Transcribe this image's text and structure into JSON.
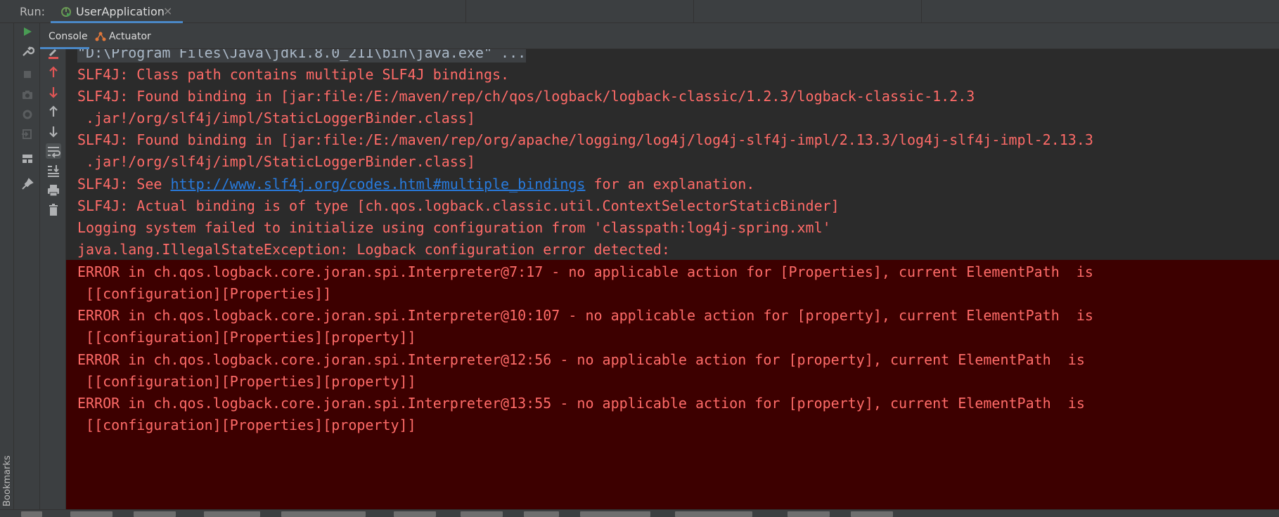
{
  "run": {
    "label": "Run:",
    "tab_label": "UserApplication",
    "tab_close": "×"
  },
  "console_tabs": [
    {
      "label": "Console",
      "active": true
    },
    {
      "label": "Actuator",
      "active": false
    }
  ],
  "bookmarks_label": "Bookmarks",
  "output": {
    "command": "\"D:\\Program Files\\Java\\jdk1.8.0_211\\bin\\java.exe\" ...",
    "lines": [
      "SLF4J: Class path contains multiple SLF4J bindings.",
      "SLF4J: Found binding in [jar:file:/E:/maven/rep/ch/qos/logback/logback-classic/1.2.3/logback-classic-1.2.3",
      " .jar!/org/slf4j/impl/StaticLoggerBinder.class]",
      "SLF4J: Found binding in [jar:file:/E:/maven/rep/org/apache/logging/log4j/log4j-slf4j-impl/2.13.3/log4j-slf4j-impl-2.13.3",
      " .jar!/org/slf4j/impl/StaticLoggerBinder.class]"
    ],
    "see_prefix": "SLF4J: See ",
    "see_link": "http://www.slf4j.org/codes.html#multiple_bindings",
    "see_suffix": " for an explanation.",
    "lines2": [
      "SLF4J: Actual binding is of type [ch.qos.logback.classic.util.ContextSelectorStaticBinder]",
      "Logging system failed to initialize using configuration from 'classpath:log4j-spring.xml'",
      "java.lang.IllegalStateException: Logback configuration error detected:"
    ],
    "errors": [
      "ERROR in ch.qos.logback.core.joran.spi.Interpreter@7:17 - no applicable action for [Properties], current ElementPath  is",
      " [[configuration][Properties]]",
      "ERROR in ch.qos.logback.core.joran.spi.Interpreter@10:107 - no applicable action for [property], current ElementPath  is",
      " [[configuration][Properties][property]]",
      "ERROR in ch.qos.logback.core.joran.spi.Interpreter@12:56 - no applicable action for [property], current ElementPath  is",
      " [[configuration][Properties][property]]",
      "ERROR in ch.qos.logback.core.joran.spi.Interpreter@13:55 - no applicable action for [property], current ElementPath  is",
      " [[configuration][Properties][property]]"
    ]
  },
  "colors": {
    "error_text": "#ff6b68",
    "error_background": "#3d0000",
    "link": "#287bde",
    "accent": "#4a88c7",
    "run_green": "#499c54"
  },
  "icons": {
    "run_tools": [
      "run-icon",
      "wrench-icon",
      "stop-icon",
      "camera-icon",
      "settings-icon",
      "exit-icon",
      "layout-icon",
      "pin-icon"
    ],
    "console_actions": [
      "clear-icon",
      "up-red-icon",
      "down-red-icon",
      "up-arrow-icon",
      "down-arrow-icon",
      "soft-wrap-icon",
      "scroll-to-end-icon",
      "print-icon",
      "trash-icon"
    ]
  }
}
